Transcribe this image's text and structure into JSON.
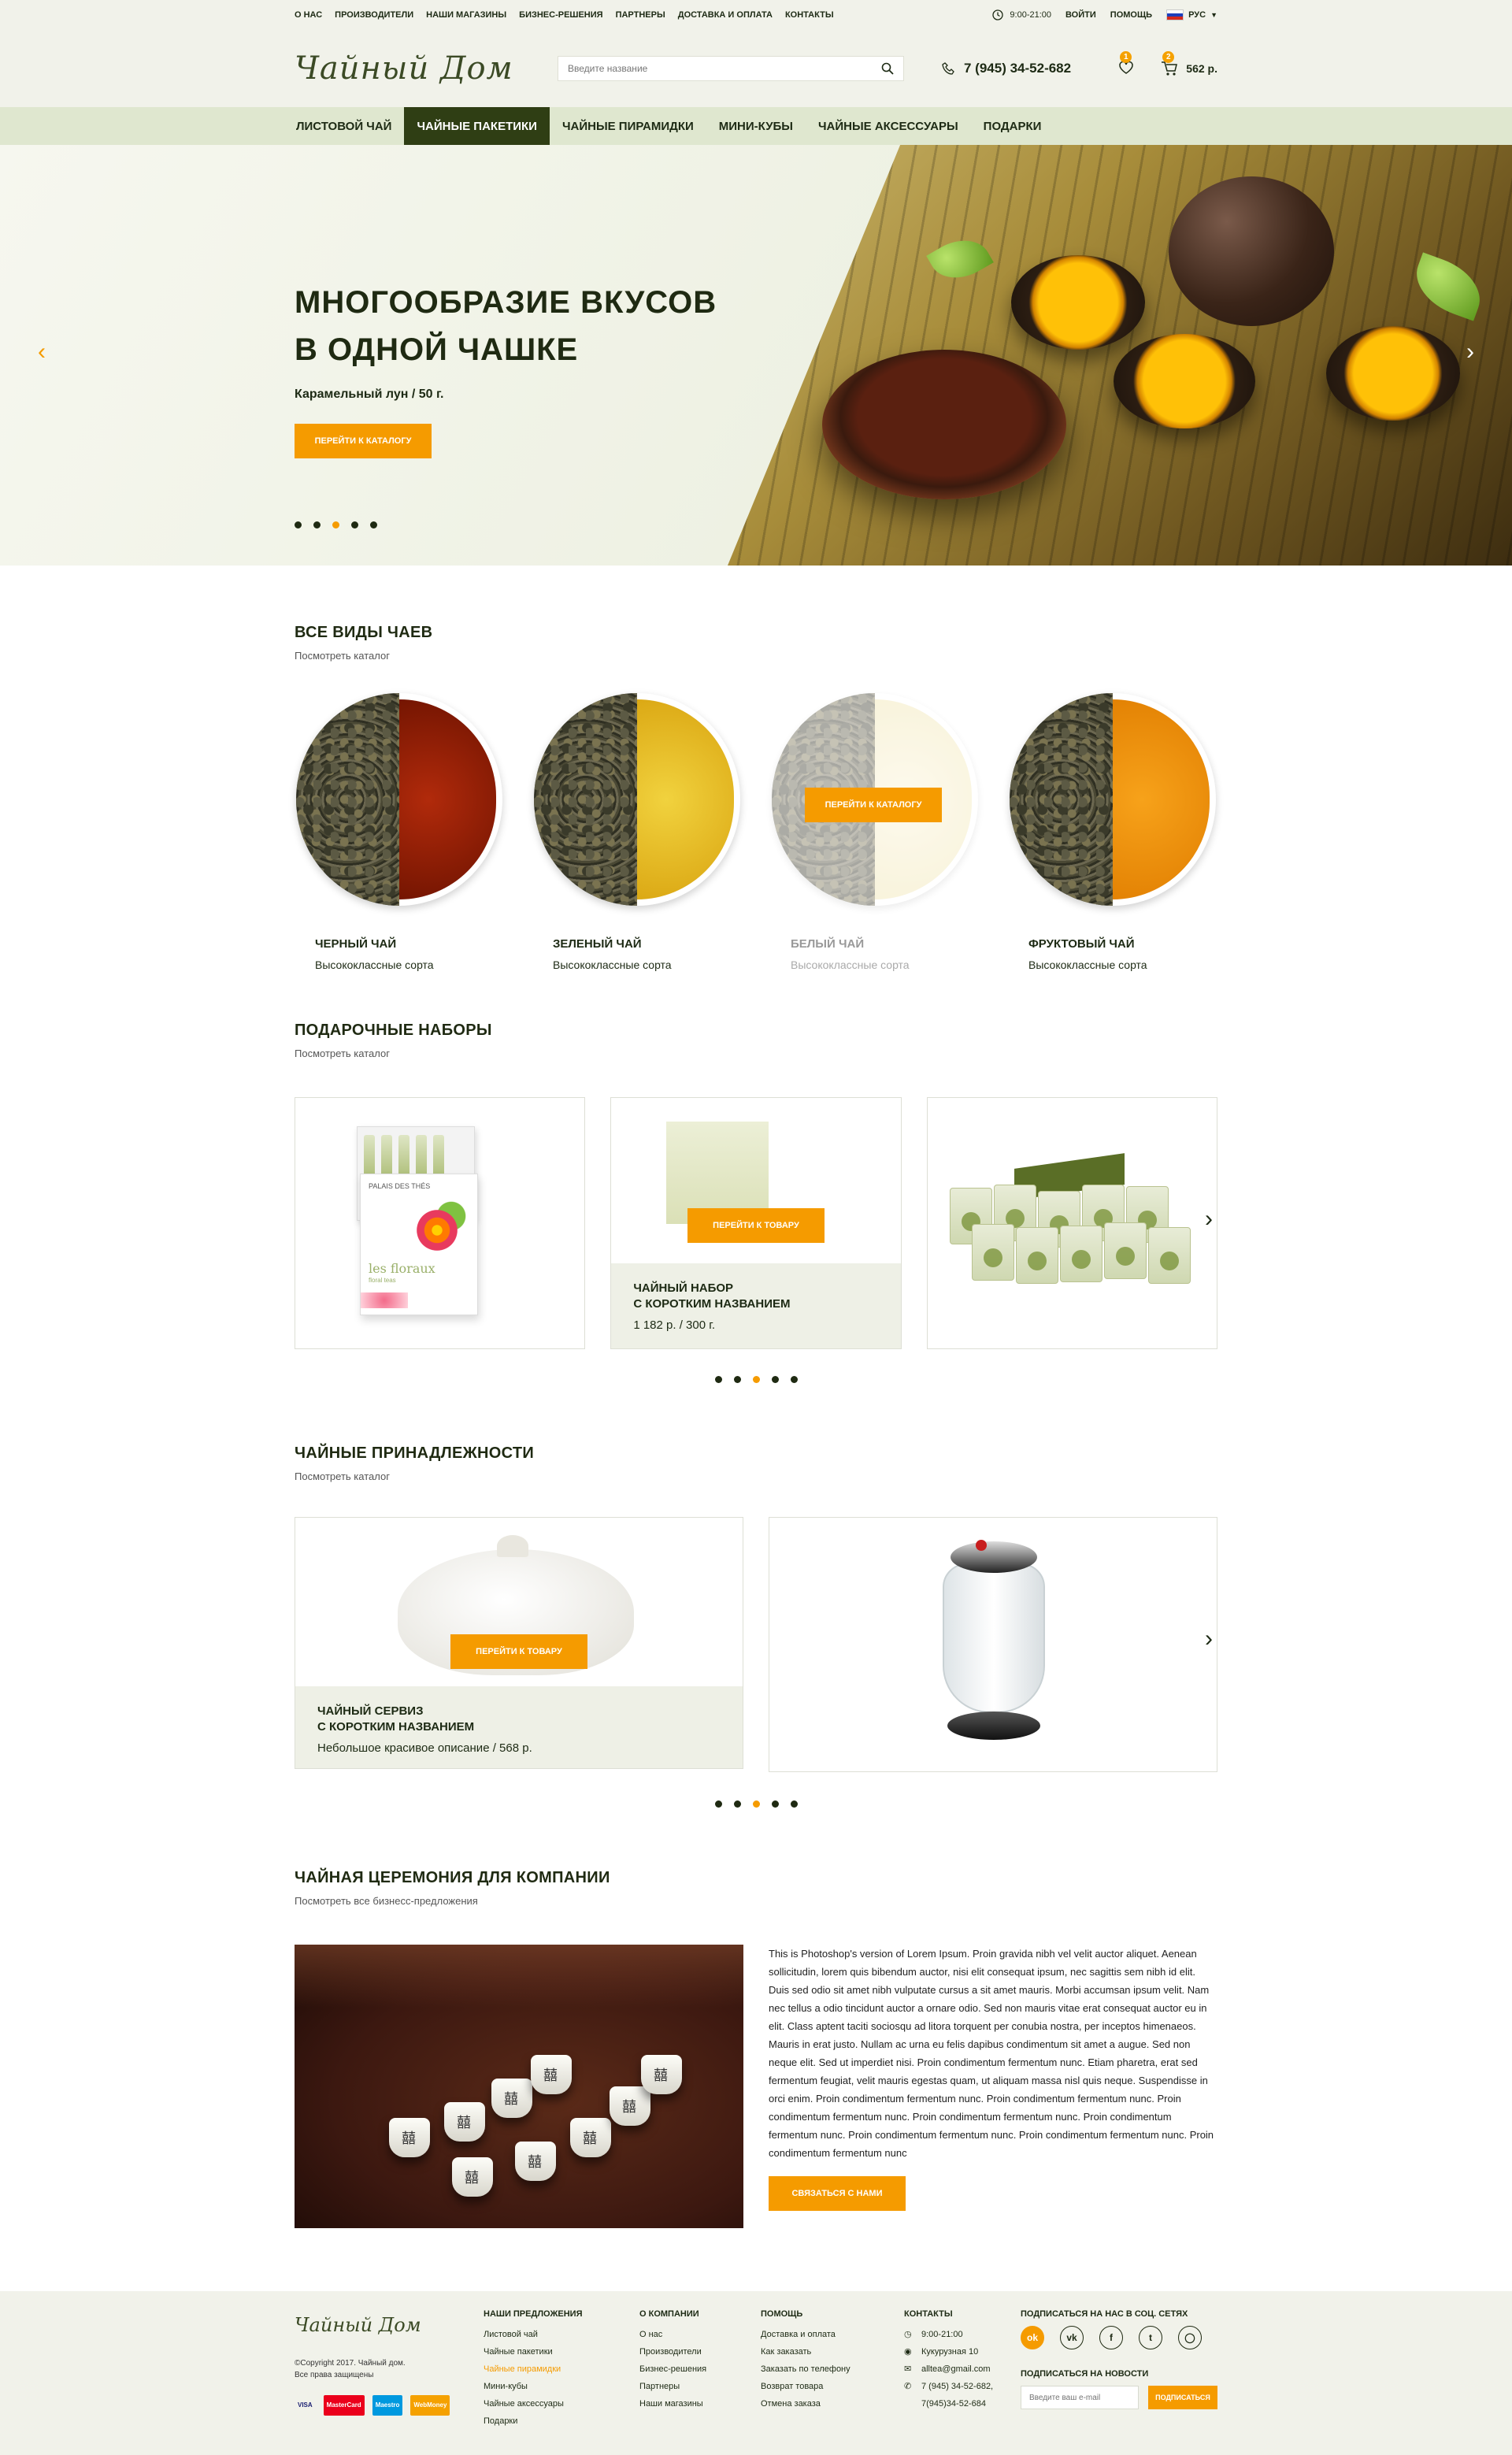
{
  "topbar": {
    "links": [
      "О НАС",
      "ПРОИЗВОДИТЕЛИ",
      "НАШИ МАГАЗИНЫ",
      "БИЗНЕС-РЕШЕНИЯ",
      "ПАРТНЕРЫ",
      "ДОСТАВКА И ОПЛАТА",
      "КОНТАКТЫ"
    ],
    "hours": "9:00-21:00",
    "login": "ВОЙТИ",
    "help": "ПОМОЩЬ",
    "lang": "РУС"
  },
  "header": {
    "logo": "Чайный Дом",
    "search_placeholder": "Введите название",
    "phone": "7 (945) 34-52-682",
    "wishlist_count": "1",
    "cart_count": "2",
    "cart_total": "562 р."
  },
  "nav": {
    "items": [
      "ЛИСТОВОЙ ЧАЙ",
      "ЧАЙНЫЕ ПАКЕТИКИ",
      "ЧАЙНЫЕ ПИРАМИДКИ",
      "МИНИ-КУБЫ",
      "ЧАЙНЫЕ АКСЕССУАРЫ",
      "ПОДАРКИ"
    ],
    "active_index": 1
  },
  "hero": {
    "title_line1": "МНОГООБРАЗИЕ ВКУСОВ",
    "title_line2": "В ОДНОЙ ЧАШКЕ",
    "subtitle": "Карамельный лун / 50 г.",
    "button": "ПЕРЕЙТИ К КАТАЛОГУ",
    "slides": 5,
    "active_slide": 3
  },
  "teas_section": {
    "title": "ВСЕ ВИДЫ ЧАЕВ",
    "subtitle": "Посмотреть каталог",
    "overlay_button": "ПЕРЕЙТИ К КАТАЛОГУ",
    "items": [
      {
        "name": "ЧЕРНЫЙ ЧАЙ",
        "desc": "Высококлассные сорта",
        "color": "#8b1a06"
      },
      {
        "name": "ЗЕЛЕНЫЙ ЧАЙ",
        "desc": "Высококлассные сорта",
        "color": "#e2b417"
      },
      {
        "name": "БЕЛЫЙ ЧАЙ",
        "desc": "Высококлассные сорта",
        "color": "#f8efc8"
      },
      {
        "name": "ФРУКТОВЫЙ ЧАЙ",
        "desc": "Высококлассные сорта",
        "color": "#ee8e06"
      }
    ]
  },
  "gifts_section": {
    "title": "ПОДАРОЧНЫЕ НАБОРЫ",
    "subtitle": "Посмотреть каталог",
    "card_button": "ПЕРЕЙТИ К ТОВАРУ",
    "card_name_line1": "ЧАЙНЫЙ НАБОР",
    "card_name_line2": "С КОРОТКИМ НАЗВАНИЕМ",
    "card_price": "1 182 р. / 300 г.",
    "box_brand": "PALAIS DES THÉS",
    "box_label": "les floraux",
    "box_sublabel": "floral teas",
    "slides": 5,
    "active_slide": 3
  },
  "accessories_section": {
    "title": "ЧАЙНЫЕ ПРИНАДЛЕЖНОСТИ",
    "subtitle": "Посмотреть каталог",
    "card_button": "ПЕРЕЙТИ К ТОВАРУ",
    "card_name_line1": "ЧАЙНЫЙ СЕРВИЗ",
    "card_name_line2": "С КОРОТКИМ НАЗВАНИЕМ",
    "card_desc": "Небольшое красивое описание / 568 р.",
    "slides": 5,
    "active_slide": 3
  },
  "business_section": {
    "title": "ЧАЙНАЯ ЦЕРЕМОНИЯ ДЛЯ КОМПАНИИ",
    "subtitle": "Посмотреть все бизнесс-предложения",
    "text": "This is Photoshop's version  of Lorem Ipsum. Proin gravida nibh vel velit auctor aliquet. Aenean sollicitudin, lorem quis bibendum auctor, nisi elit consequat ipsum, nec sagittis sem nibh id elit. Duis sed odio sit amet nibh vulputate cursus a sit amet mauris. Morbi accumsan ipsum velit. Nam nec tellus a odio tincidunt auctor a ornare odio. Sed non mauris vitae erat consequat auctor eu in elit. Class aptent taciti sociosqu ad litora torquent per conubia nostra, per inceptos himenaeos. Mauris in erat justo. Nullam ac urna eu felis dapibus condimentum sit amet a augue. Sed non neque elit. Sed ut imperdiet nisi. Proin condimentum fermentum nunc. Etiam pharetra, erat sed fermentum feugiat, velit mauris egestas quam, ut aliquam massa nisl quis neque. Suspendisse in orci enim. Proin condimentum fermentum nunc. Proin condimentum fermentum nunc. Proin condimentum fermentum nunc. Proin condimentum fermentum nunc. Proin condimentum fermentum nunc. Proin condimentum fermentum nunc. Proin condimentum fermentum nunc. Proin condimentum fermentum nunc",
    "button": "СВЯЗАТЬСЯ С НАМИ"
  },
  "footer": {
    "logo": "Чайный Дом",
    "copyright_line1": "©Copyright 2017.  Чайный дом.",
    "copyright_line2": "Все права защищены",
    "payments": [
      "VISA",
      "MasterCard",
      "Maestro",
      "WebMoney"
    ],
    "offers": {
      "title": "НАШИ ПРЕДЛОЖЕНИЯ",
      "items": [
        "Листовой чай",
        "Чайные пакетики",
        "Чайные пирамидки",
        "Мини-кубы",
        "Чайные аксессуары",
        "Подарки"
      ],
      "highlight_index": 2
    },
    "company": {
      "title": "О КОМПАНИИ",
      "items": [
        "О нас",
        "Производители",
        "Бизнес-решения",
        "Партнеры",
        "Наши магазины"
      ]
    },
    "help": {
      "title": "ПОМОЩЬ",
      "items": [
        "Доставка и оплата",
        "Как заказать",
        "Заказать по телефону",
        "Возврат товара",
        "Отмена заказа"
      ]
    },
    "contacts": {
      "title": "КОНТАКТЫ",
      "hours": "9:00-21:00",
      "address": "Кукурузная 10",
      "email": "alltea@gmail.com",
      "phone1": "7 (945) 34-52-682,",
      "phone2": "7(945)34-52-684"
    },
    "social_title": "ПОДПИСАТЬСЯ НА НАС В СОЦ. СЕТЯХ",
    "news_title": "ПОДПИСАТЬСЯ НА НОВОСТИ",
    "email_placeholder": "Введите ваш e-mail",
    "subscribe_button": "ПОДПИСАТЬСЯ"
  },
  "colors": {
    "accent": "#f59b00",
    "dark": "#2f3e14",
    "nav_bg": "#dfe7cf",
    "header_bg": "#f1f2ea"
  }
}
